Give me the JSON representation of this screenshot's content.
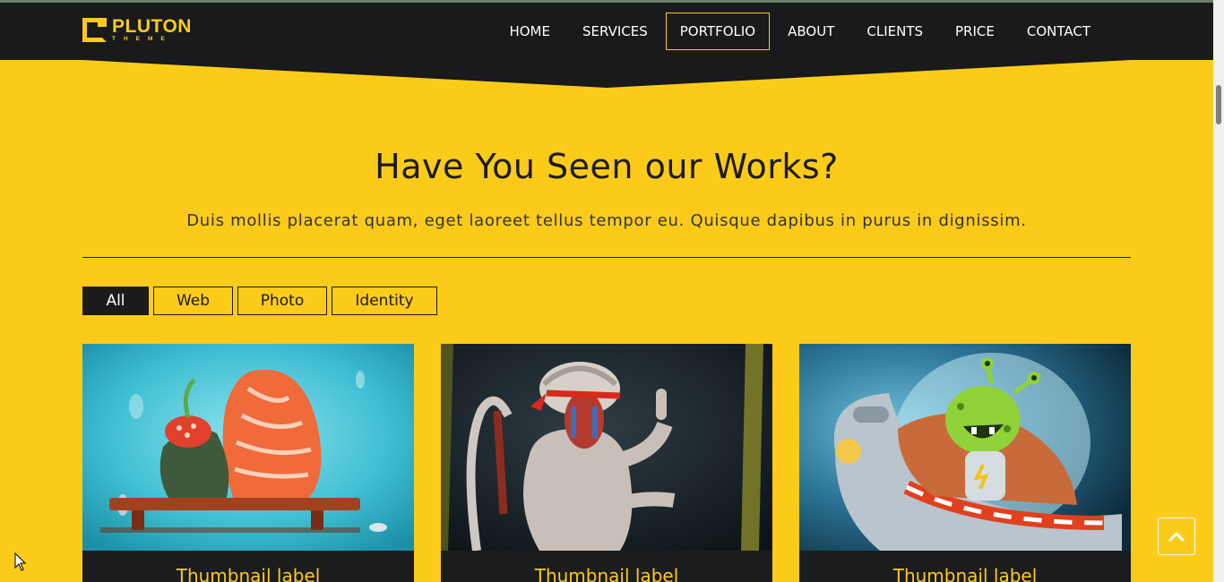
{
  "brand": {
    "name": "PLUTON",
    "tagline": "THEME",
    "accent": "#fccb1a",
    "nav_bg": "#181a1c"
  },
  "nav": {
    "items": [
      {
        "label": "HOME",
        "active": false
      },
      {
        "label": "SERVICES",
        "active": false
      },
      {
        "label": "PORTFOLIO",
        "active": true
      },
      {
        "label": "ABOUT",
        "active": false
      },
      {
        "label": "CLIENTS",
        "active": false
      },
      {
        "label": "PRICE",
        "active": false
      },
      {
        "label": "CONTACT",
        "active": false
      }
    ]
  },
  "section": {
    "title": "Have You Seen our Works?",
    "subtitle": "Duis mollis placerat quam, eget laoreet tellus tempor eu. Quisque dapibus in purus in dignissim."
  },
  "filters": [
    {
      "label": "All",
      "active": true
    },
    {
      "label": "Web",
      "active": false
    },
    {
      "label": "Photo",
      "active": false
    },
    {
      "label": "Identity",
      "active": false
    }
  ],
  "portfolio": [
    {
      "label": "Thumbnail label",
      "image": "sushi-couple-on-bench"
    },
    {
      "label": "Thumbnail label",
      "image": "ninja-baboon"
    },
    {
      "label": "Thumbnail label",
      "image": "alien-in-spaceship"
    }
  ],
  "controls": {
    "back_to_top_icon": "chevron-up-icon"
  }
}
